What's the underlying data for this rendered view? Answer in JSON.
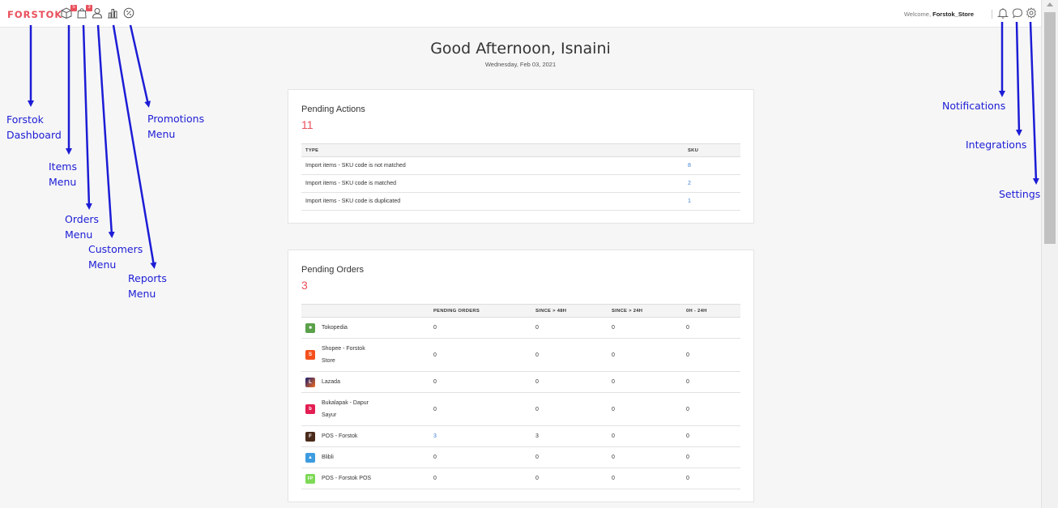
{
  "topbar": {
    "logo": "FORSTOK",
    "nav": [
      {
        "icon": "items-box-icon",
        "badge": "5"
      },
      {
        "icon": "orders-bag-icon",
        "badge": "3"
      },
      {
        "icon": "customers-user-icon"
      },
      {
        "icon": "reports-bar-chart-icon"
      },
      {
        "icon": "promotions-percent-icon"
      }
    ],
    "welcome_prefix": "Welcome,",
    "welcome_user": "Forstok_Store",
    "right_icons": [
      "bell-icon",
      "chat-bubble-icon",
      "gear-icon"
    ]
  },
  "greeting": {
    "title": "Good Afternoon, Isnaini",
    "date": "Wednesday, Feb 03, 2021"
  },
  "pending_actions": {
    "title": "Pending Actions",
    "count": "11",
    "columns": [
      "TYPE",
      "SKU"
    ],
    "rows": [
      {
        "type": "Import items - SKU code is not matched",
        "sku": "8"
      },
      {
        "type": "Import items - SKU code is matched",
        "sku": "2"
      },
      {
        "type": "Import items - SKU code is duplicated",
        "sku": "1"
      }
    ]
  },
  "pending_orders": {
    "title": "Pending Orders",
    "count": "3",
    "columns": [
      "",
      "PENDING ORDERS",
      "SINCE > 48H",
      "SINCE > 24H",
      "0H - 24H"
    ],
    "rows": [
      {
        "channel": "Tokopedia",
        "logo": "tokopedia-logo-icon",
        "pending": "0",
        "gt48": "0",
        "gt24": "0",
        "h0_24": "0"
      },
      {
        "channel": "Shopee - Forstok Store",
        "logo": "shopee-logo-icon",
        "pending": "0",
        "gt48": "0",
        "gt24": "0",
        "h0_24": "0"
      },
      {
        "channel": "Lazada",
        "logo": "lazada-logo-icon",
        "pending": "0",
        "gt48": "0",
        "gt24": "0",
        "h0_24": "0"
      },
      {
        "channel": "Bukalapak - Dapur Sayur",
        "logo": "bukalapak-logo-icon",
        "pending": "0",
        "gt48": "0",
        "gt24": "0",
        "h0_24": "0"
      },
      {
        "channel": "POS - Forstok",
        "logo": "pos-forstok-logo-icon",
        "logo_text": "F",
        "pending": "3",
        "gt48": "3",
        "gt24": "0",
        "h0_24": "0"
      },
      {
        "channel": "Blibli",
        "logo": "blibli-logo-icon",
        "pending": "0",
        "gt48": "0",
        "gt24": "0",
        "h0_24": "0"
      },
      {
        "channel": "POS - Forstok POS",
        "logo": "forstok-pos-logo-icon",
        "logo_text": "FP",
        "pending": "0",
        "gt48": "0",
        "gt24": "0",
        "h0_24": "0"
      }
    ]
  },
  "annotations": {
    "dashboard": "Forstok\nDashboard",
    "items": "Items\nMenu",
    "orders": "Orders\nMenu",
    "customers": "Customers\nMenu",
    "reports": "Reports\nMenu",
    "promotions": "Promotions\nMenu",
    "notifications": "Notifications",
    "integrations": "Integrations",
    "settings": "Settings"
  },
  "colors": {
    "brand": "#e8505b",
    "link": "#3d7fd6",
    "annotation": "#1c1cd6"
  }
}
